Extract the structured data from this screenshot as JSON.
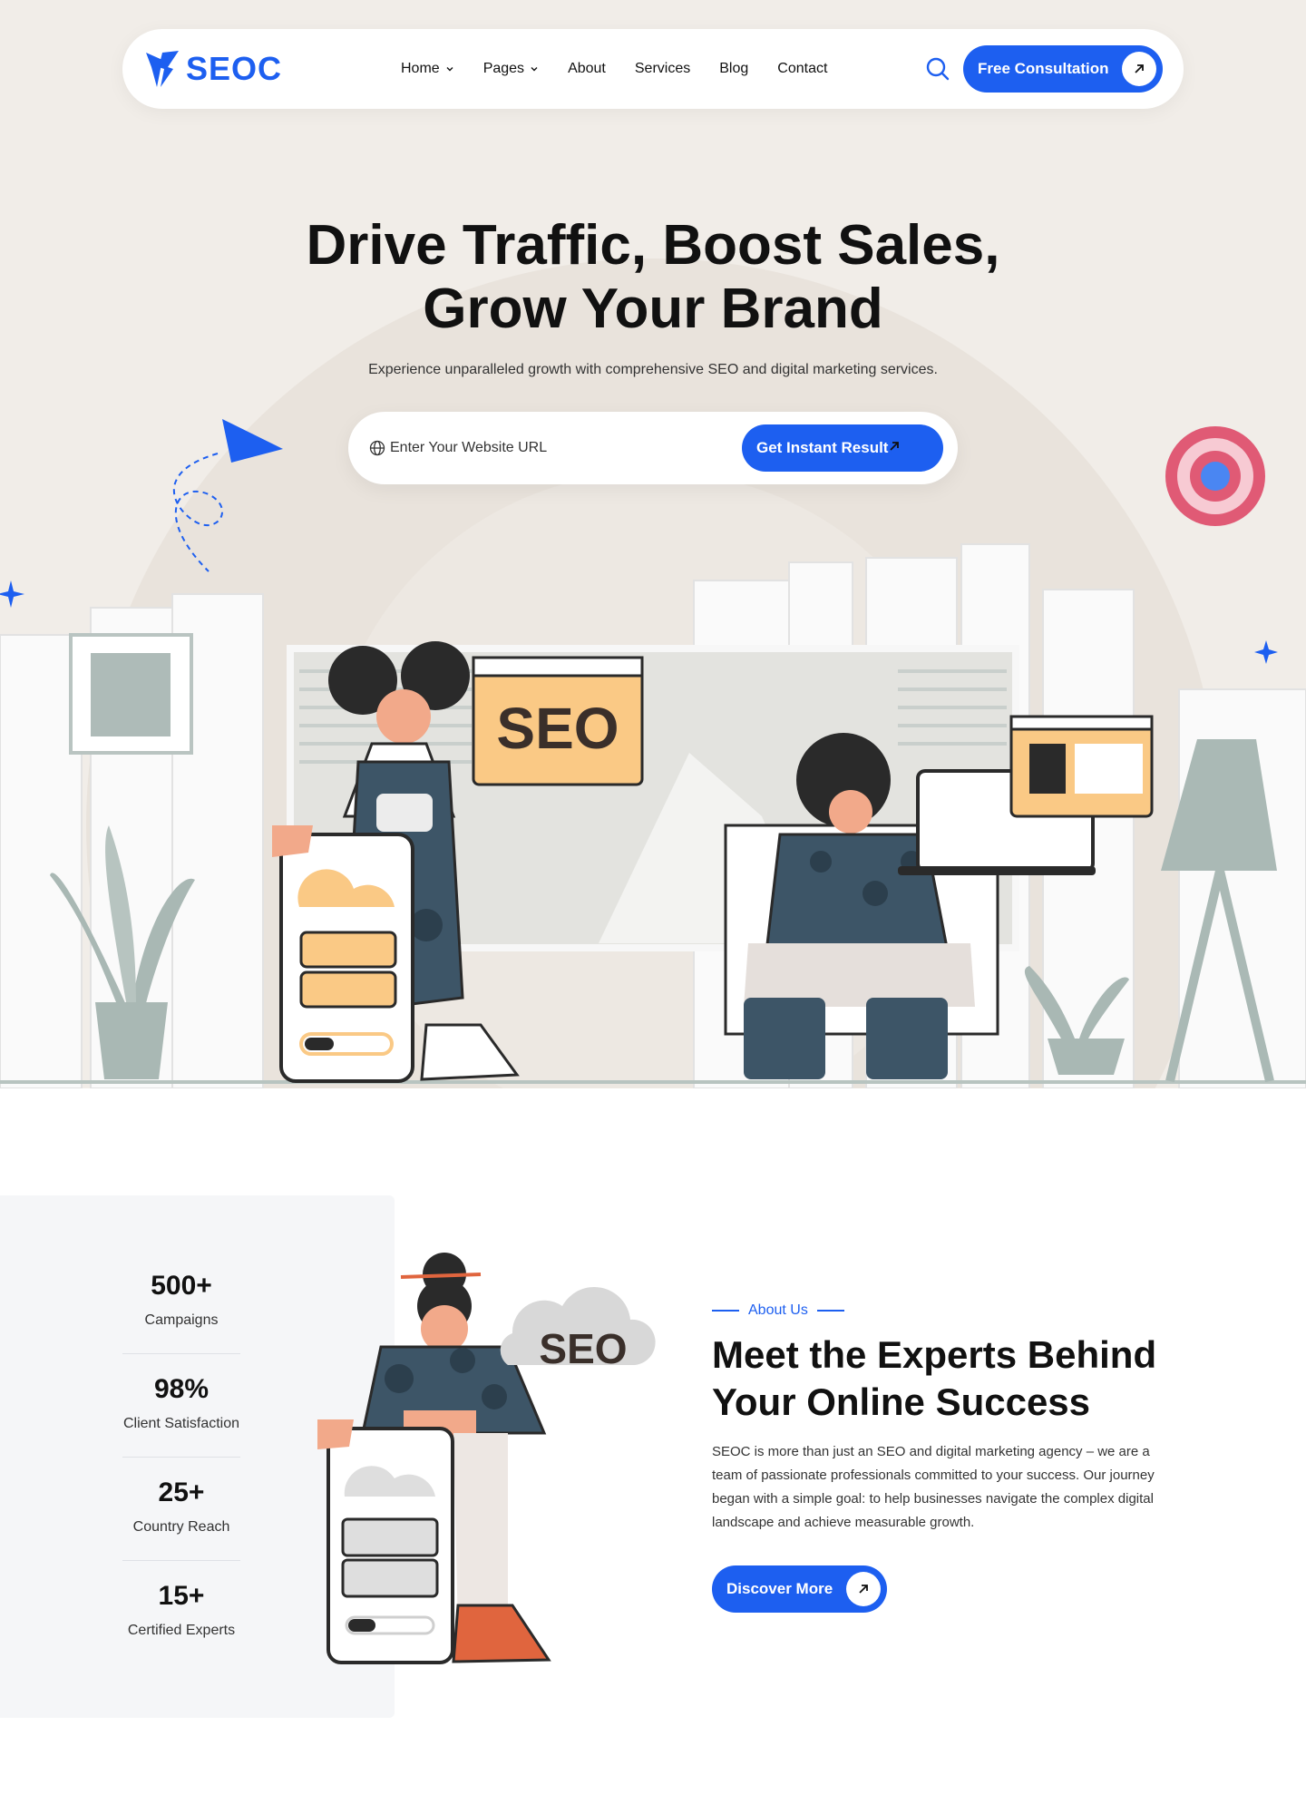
{
  "brand": {
    "name": "SEOC",
    "accent": "#1d5ff0"
  },
  "nav": {
    "items": [
      {
        "label": "Home",
        "has_dropdown": true
      },
      {
        "label": "Pages",
        "has_dropdown": true
      },
      {
        "label": "About",
        "has_dropdown": false
      },
      {
        "label": "Services",
        "has_dropdown": false
      },
      {
        "label": "Blog",
        "has_dropdown": false
      },
      {
        "label": "Contact",
        "has_dropdown": false
      }
    ],
    "search_icon": "search-icon",
    "cta_label": "Free Consultation"
  },
  "hero": {
    "title_line1": "Drive Traffic, Boost Sales,",
    "title_line2": "Grow Your Brand",
    "subtitle": "Experience unparalleled growth with comprehensive SEO and digital marketing services.",
    "url_placeholder": "Enter Your Website URL",
    "url_button": "Get Instant Result",
    "illustration_sign": "SEO"
  },
  "stats": [
    {
      "value": "500+",
      "label": "Campaigns"
    },
    {
      "value": "98%",
      "label": "Client Satisfaction"
    },
    {
      "value": "25+",
      "label": "Country Reach"
    },
    {
      "value": "15+",
      "label": "Certified Experts"
    }
  ],
  "about": {
    "eyebrow": "About Us",
    "title": "Meet the Experts Behind Your Online Success",
    "text": "SEOC is more than just an SEO and digital marketing agency – we are a team of passionate professionals committed to your success. Our journey began with a simple goal: to help businesses navigate the complex digital landscape and achieve measurable growth.",
    "button": "Discover More",
    "illustration_sign": "SEO"
  }
}
